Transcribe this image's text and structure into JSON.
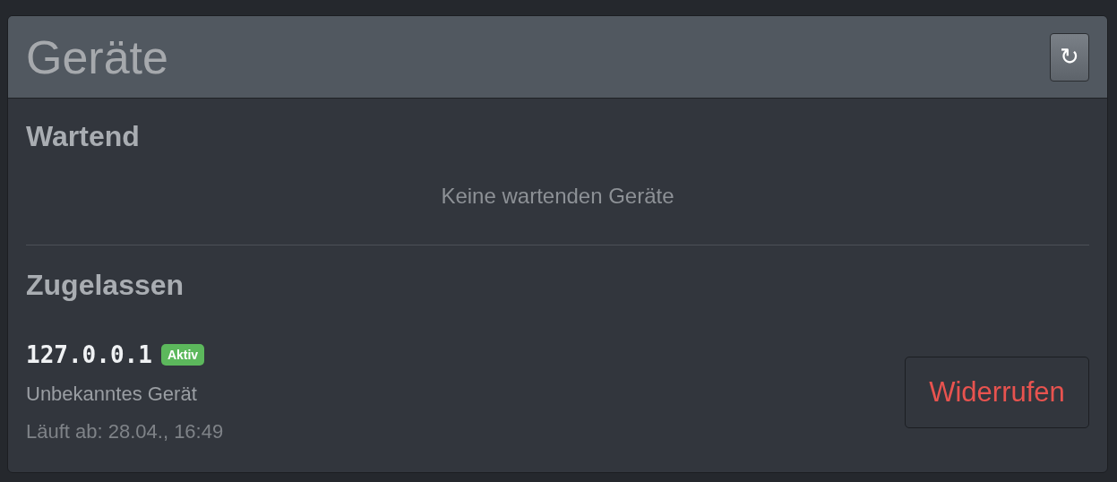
{
  "panel": {
    "title": "Geräte",
    "refresh_button": "↻"
  },
  "sections": [
    {
      "title": "Wartend",
      "empty_text": "Keine wartenden Geräte"
    },
    {
      "title": "Zugelassen",
      "devices": [
        {
          "address": "127.0.0.1",
          "badge": {
            "label": "Aktiv",
            "kind": "success"
          },
          "name": "Unbekanntes Gerät",
          "expires": "Läuft ab: 28.04., 16:49",
          "action": "Widerrufen"
        }
      ]
    }
  ]
}
